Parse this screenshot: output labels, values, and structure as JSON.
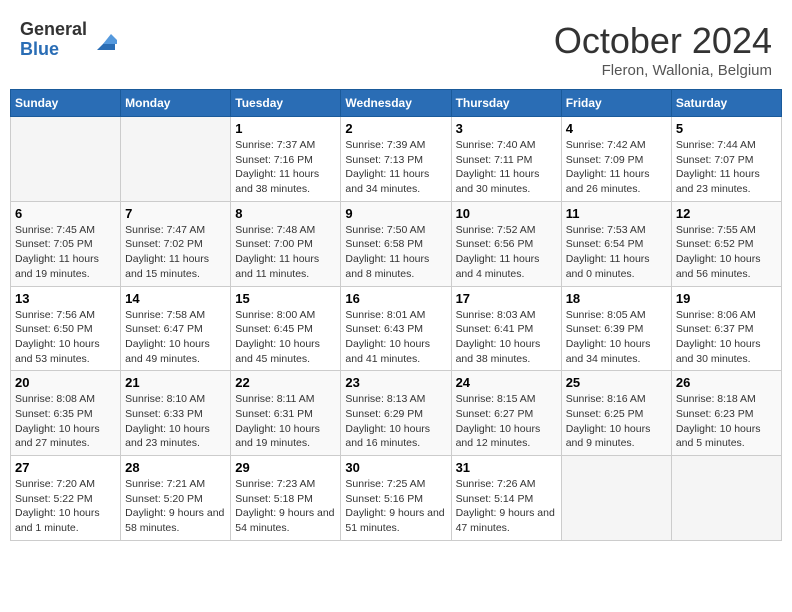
{
  "header": {
    "logo": {
      "general": "General",
      "blue": "Blue"
    },
    "title": "October 2024",
    "location": "Fleron, Wallonia, Belgium"
  },
  "days_of_week": [
    "Sunday",
    "Monday",
    "Tuesday",
    "Wednesday",
    "Thursday",
    "Friday",
    "Saturday"
  ],
  "weeks": [
    [
      {
        "day": "",
        "info": ""
      },
      {
        "day": "",
        "info": ""
      },
      {
        "day": "1",
        "info": "Sunrise: 7:37 AM\nSunset: 7:16 PM\nDaylight: 11 hours and 38 minutes."
      },
      {
        "day": "2",
        "info": "Sunrise: 7:39 AM\nSunset: 7:13 PM\nDaylight: 11 hours and 34 minutes."
      },
      {
        "day": "3",
        "info": "Sunrise: 7:40 AM\nSunset: 7:11 PM\nDaylight: 11 hours and 30 minutes."
      },
      {
        "day": "4",
        "info": "Sunrise: 7:42 AM\nSunset: 7:09 PM\nDaylight: 11 hours and 26 minutes."
      },
      {
        "day": "5",
        "info": "Sunrise: 7:44 AM\nSunset: 7:07 PM\nDaylight: 11 hours and 23 minutes."
      }
    ],
    [
      {
        "day": "6",
        "info": "Sunrise: 7:45 AM\nSunset: 7:05 PM\nDaylight: 11 hours and 19 minutes."
      },
      {
        "day": "7",
        "info": "Sunrise: 7:47 AM\nSunset: 7:02 PM\nDaylight: 11 hours and 15 minutes."
      },
      {
        "day": "8",
        "info": "Sunrise: 7:48 AM\nSunset: 7:00 PM\nDaylight: 11 hours and 11 minutes."
      },
      {
        "day": "9",
        "info": "Sunrise: 7:50 AM\nSunset: 6:58 PM\nDaylight: 11 hours and 8 minutes."
      },
      {
        "day": "10",
        "info": "Sunrise: 7:52 AM\nSunset: 6:56 PM\nDaylight: 11 hours and 4 minutes."
      },
      {
        "day": "11",
        "info": "Sunrise: 7:53 AM\nSunset: 6:54 PM\nDaylight: 11 hours and 0 minutes."
      },
      {
        "day": "12",
        "info": "Sunrise: 7:55 AM\nSunset: 6:52 PM\nDaylight: 10 hours and 56 minutes."
      }
    ],
    [
      {
        "day": "13",
        "info": "Sunrise: 7:56 AM\nSunset: 6:50 PM\nDaylight: 10 hours and 53 minutes."
      },
      {
        "day": "14",
        "info": "Sunrise: 7:58 AM\nSunset: 6:47 PM\nDaylight: 10 hours and 49 minutes."
      },
      {
        "day": "15",
        "info": "Sunrise: 8:00 AM\nSunset: 6:45 PM\nDaylight: 10 hours and 45 minutes."
      },
      {
        "day": "16",
        "info": "Sunrise: 8:01 AM\nSunset: 6:43 PM\nDaylight: 10 hours and 41 minutes."
      },
      {
        "day": "17",
        "info": "Sunrise: 8:03 AM\nSunset: 6:41 PM\nDaylight: 10 hours and 38 minutes."
      },
      {
        "day": "18",
        "info": "Sunrise: 8:05 AM\nSunset: 6:39 PM\nDaylight: 10 hours and 34 minutes."
      },
      {
        "day": "19",
        "info": "Sunrise: 8:06 AM\nSunset: 6:37 PM\nDaylight: 10 hours and 30 minutes."
      }
    ],
    [
      {
        "day": "20",
        "info": "Sunrise: 8:08 AM\nSunset: 6:35 PM\nDaylight: 10 hours and 27 minutes."
      },
      {
        "day": "21",
        "info": "Sunrise: 8:10 AM\nSunset: 6:33 PM\nDaylight: 10 hours and 23 minutes."
      },
      {
        "day": "22",
        "info": "Sunrise: 8:11 AM\nSunset: 6:31 PM\nDaylight: 10 hours and 19 minutes."
      },
      {
        "day": "23",
        "info": "Sunrise: 8:13 AM\nSunset: 6:29 PM\nDaylight: 10 hours and 16 minutes."
      },
      {
        "day": "24",
        "info": "Sunrise: 8:15 AM\nSunset: 6:27 PM\nDaylight: 10 hours and 12 minutes."
      },
      {
        "day": "25",
        "info": "Sunrise: 8:16 AM\nSunset: 6:25 PM\nDaylight: 10 hours and 9 minutes."
      },
      {
        "day": "26",
        "info": "Sunrise: 8:18 AM\nSunset: 6:23 PM\nDaylight: 10 hours and 5 minutes."
      }
    ],
    [
      {
        "day": "27",
        "info": "Sunrise: 7:20 AM\nSunset: 5:22 PM\nDaylight: 10 hours and 1 minute."
      },
      {
        "day": "28",
        "info": "Sunrise: 7:21 AM\nSunset: 5:20 PM\nDaylight: 9 hours and 58 minutes."
      },
      {
        "day": "29",
        "info": "Sunrise: 7:23 AM\nSunset: 5:18 PM\nDaylight: 9 hours and 54 minutes."
      },
      {
        "day": "30",
        "info": "Sunrise: 7:25 AM\nSunset: 5:16 PM\nDaylight: 9 hours and 51 minutes."
      },
      {
        "day": "31",
        "info": "Sunrise: 7:26 AM\nSunset: 5:14 PM\nDaylight: 9 hours and 47 minutes."
      },
      {
        "day": "",
        "info": ""
      },
      {
        "day": "",
        "info": ""
      }
    ]
  ]
}
